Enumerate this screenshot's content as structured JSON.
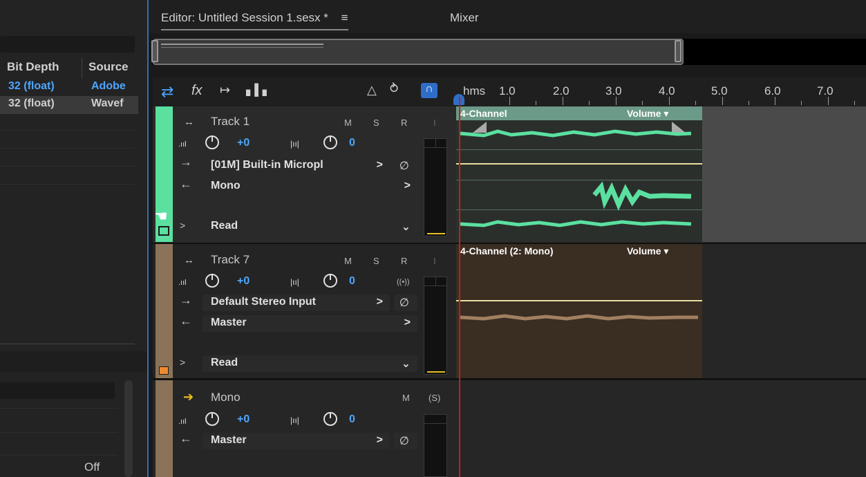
{
  "files_panel": {
    "columns": [
      "Bit Depth",
      "Source"
    ],
    "rows": [
      {
        "bit_depth": "32 (float)",
        "source": "Adobe"
      },
      {
        "bit_depth": "32 (float)",
        "source": "Wavef"
      }
    ],
    "off_label": "Off"
  },
  "tabs": {
    "editor": "Editor: Untitled Session 1.sesx *",
    "menu_icon": "≡",
    "mixer": "Mixer"
  },
  "ruler": {
    "unit": "hms",
    "labels": [
      "1.0",
      "2.0",
      "3.0",
      "4.0",
      "5.0",
      "6.0",
      "7.0"
    ]
  },
  "tracks": [
    {
      "name": "Track 1",
      "m": "M",
      "s": "S",
      "r": "R",
      "i": "I",
      "volume": "+0",
      "pan": "0",
      "input": "[01M] Built-in Micropl",
      "output": "Mono",
      "automation": "Read",
      "clip_name": "4-Channel",
      "clip_param": "Volume"
    },
    {
      "name": "Track 7",
      "m": "M",
      "s": "S",
      "r": "R",
      "i": "I",
      "volume": "+0",
      "pan": "0",
      "input": "Default Stereo Input",
      "output": "Master",
      "automation": "Read",
      "clip_name": "4-Channel (2: Mono)",
      "clip_param": "Volume"
    },
    {
      "name": "Mono",
      "m": "M",
      "s": "(S)",
      "volume": "+0",
      "pan": "0",
      "output": "Master"
    }
  ],
  "colors": {
    "track1": "#5be0a0",
    "track7": "#8a7358",
    "accent": "#4da6ff",
    "playhead": "#c02020"
  }
}
